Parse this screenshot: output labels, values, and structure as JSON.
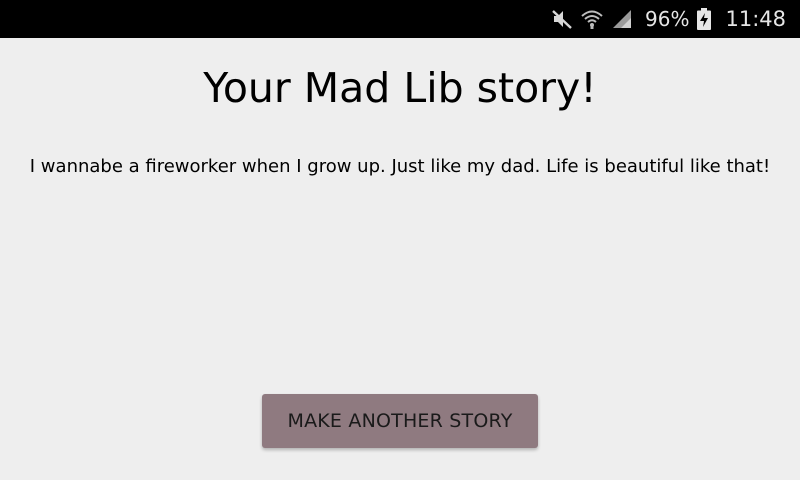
{
  "status_bar": {
    "battery_percent": "96%",
    "time": "11:48",
    "icons": [
      "mute-icon",
      "wifi-icon",
      "signal-icon",
      "battery-charging-icon"
    ]
  },
  "main": {
    "title": "Your Mad Lib story!",
    "story_text": "I wannabe a fireworker when I grow up. Just like my dad. Life is beautiful like that!",
    "button_label": "MAKE ANOTHER STORY"
  },
  "colors": {
    "background": "#eeeeee",
    "status_bar": "#000000",
    "button": "#8f7a80"
  }
}
